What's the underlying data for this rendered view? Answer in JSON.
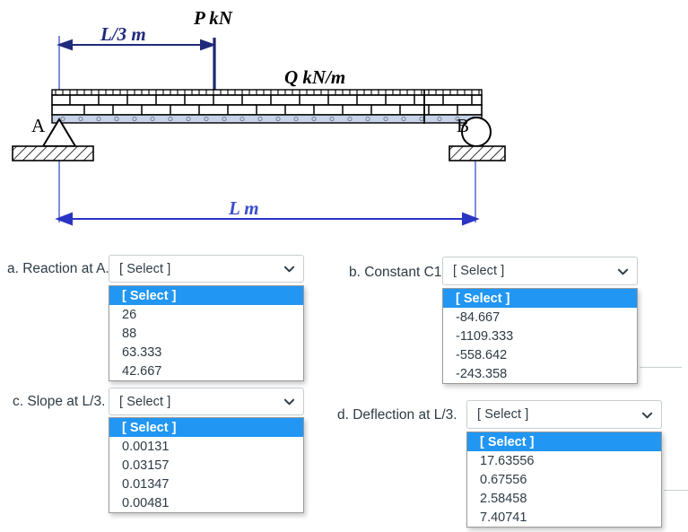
{
  "diagram": {
    "title": "simply supported beam with point load and uniform distributed load",
    "labels": {
      "point_load": "P kN",
      "distributed_load": "Q kN/m",
      "dim_left": "L/3 m",
      "dim_total": "L m",
      "support_a": "A",
      "support_b": "B"
    },
    "colors": {
      "dim_navy": "#202a7c",
      "dim_blue": "#3b4ecb",
      "beam_band": "#c6d3e8",
      "ink": "#000000"
    }
  },
  "questions": [
    {
      "id": "a",
      "label": "a. Reaction at A.",
      "value": "[ Select ]",
      "open": true,
      "options": [
        "[ Select ]",
        "26",
        "88",
        "63.333",
        "42.667"
      ],
      "selected_index": 0
    },
    {
      "id": "b",
      "label": "b. Constant C1.",
      "value": "[ Select ]",
      "open": true,
      "options": [
        "[ Select ]",
        "-84.667",
        "-1109.333",
        "-558.642",
        "-243.358"
      ],
      "selected_index": 0
    },
    {
      "id": "c",
      "label": "c. Slope at L/3.",
      "value": "[ Select ]",
      "open": true,
      "options": [
        "[ Select ]",
        "0.00131",
        "0.03157",
        "0.01347",
        "0.00481"
      ],
      "selected_index": 0
    },
    {
      "id": "d",
      "label": "d. Deflection at L/3.",
      "value": "[ Select ]",
      "open": true,
      "options": [
        "[ Select ]",
        "17.63556",
        "0.67556",
        "2.58458",
        "7.40741"
      ],
      "selected_index": 0
    }
  ]
}
